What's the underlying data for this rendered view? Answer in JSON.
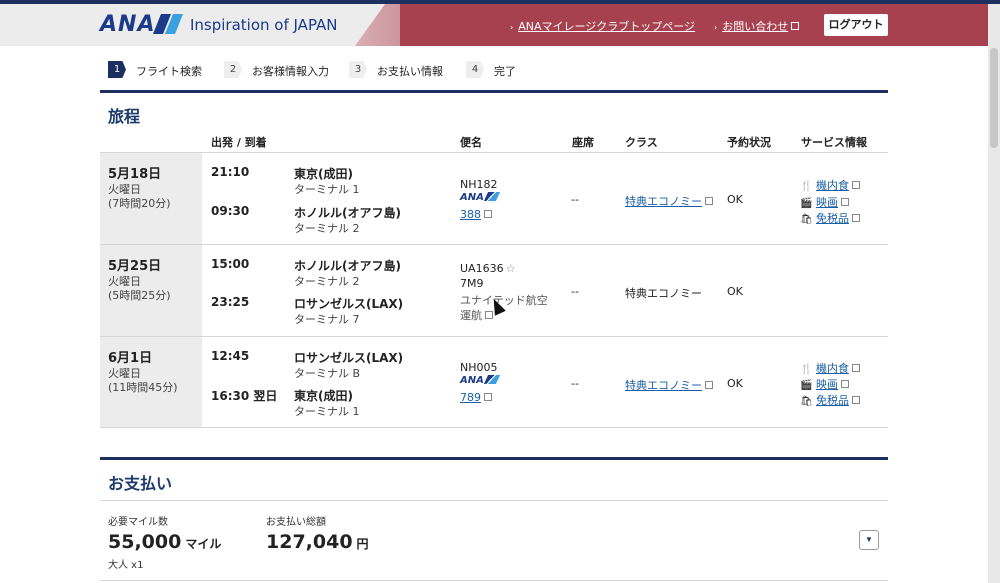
{
  "header": {
    "brand": "ANA",
    "tagline": "Inspiration of JAPAN",
    "links": [
      {
        "label": "ANAマイレージクラブトップページ"
      },
      {
        "label": "お問い合わせ"
      }
    ],
    "logout_label": "ログアウト",
    "colors": {
      "navy": "#1c2f5e",
      "banner": "#a8414f",
      "link": "#1a5fa8"
    }
  },
  "steps": [
    {
      "num": "1",
      "label": "フライト検索",
      "active": true
    },
    {
      "num": "2",
      "label": "お客様情報入力",
      "active": false
    },
    {
      "num": "3",
      "label": "お支払い情報",
      "active": false
    },
    {
      "num": "4",
      "label": "完了",
      "active": false
    }
  ],
  "itinerary": {
    "title": "旅程",
    "columns": {
      "depart_arrive": "出発 / 到着",
      "flight": "便名",
      "seat": "座席",
      "class": "クラス",
      "status": "予約状況",
      "service": "サービス情報"
    },
    "segments": [
      {
        "date": "5月18日",
        "weekday": "火曜日",
        "duration": "(7時間20分)",
        "dep_time": "21:10",
        "dep_place": "東京(成田)",
        "dep_terminal": "ターミナル 1",
        "arr_time": "09:30",
        "arr_place": "ホノルル(オアフ島)",
        "arr_terminal": "ターミナル 2",
        "flight_no": "NH182",
        "carrier_logo": "ANA",
        "aircraft": "388",
        "seat": "--",
        "class": "特典エコノミー",
        "status": "OK",
        "services": [
          {
            "icon": "meal-icon",
            "label": "機内食"
          },
          {
            "icon": "movie-icon",
            "label": "映画"
          },
          {
            "icon": "dutyfree-icon",
            "label": "免税品"
          }
        ]
      },
      {
        "date": "5月25日",
        "weekday": "火曜日",
        "duration": "(5時間25分)",
        "dep_time": "15:00",
        "dep_place": "ホノルル(オアフ島)",
        "dep_terminal": "ターミナル 2",
        "arr_time": "23:25",
        "arr_place": "ロサンゼルス(LAX)",
        "arr_terminal": "ターミナル 7",
        "flight_no": "UA1636",
        "aircraft": "7M9",
        "operated_by": "ユナイテッド航空",
        "operated_suffix": "運航",
        "seat": "--",
        "class": "特典エコノミー",
        "status": "OK"
      },
      {
        "date": "6月1日",
        "weekday": "火曜日",
        "duration": "(11時間45分)",
        "dep_time": "12:45",
        "dep_place": "ロサンゼルス(LAX)",
        "dep_terminal": "ターミナル B",
        "arr_time": "16:30 翌日",
        "arr_place": "東京(成田)",
        "arr_terminal": "ターミナル 1",
        "flight_no": "NH005",
        "carrier_logo": "ANA",
        "aircraft": "789",
        "seat": "--",
        "class": "特典エコノミー",
        "status": "OK",
        "services": [
          {
            "icon": "meal-icon",
            "label": "機内食"
          },
          {
            "icon": "movie-icon",
            "label": "映画"
          },
          {
            "icon": "dutyfree-icon",
            "label": "免税品"
          }
        ]
      }
    ]
  },
  "payment": {
    "title": "お支払い",
    "miles_label": "必要マイル数",
    "miles_value": "55,000",
    "miles_unit": "マイル",
    "passengers": "大人 x1",
    "total_label": "お支払い総額",
    "total_value": "127,040",
    "total_unit": "円"
  }
}
